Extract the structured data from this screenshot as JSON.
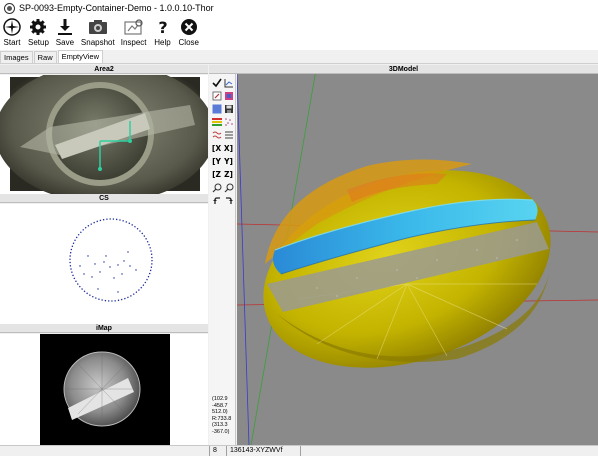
{
  "window": {
    "title": "SP-0093-Empty-Container-Demo - 1.0.0.10-Thor"
  },
  "toolbar": {
    "buttons": [
      {
        "label": "Start",
        "icon": "start-icon"
      },
      {
        "label": "Setup",
        "icon": "gear-icon"
      },
      {
        "label": "Save",
        "icon": "download-icon"
      },
      {
        "label": "Snapshot",
        "icon": "camera-icon"
      },
      {
        "label": "Inspect",
        "icon": "inspect-icon"
      },
      {
        "label": "Help",
        "icon": "help-icon"
      },
      {
        "label": "Close",
        "icon": "close-icon"
      }
    ]
  },
  "tabs": [
    {
      "label": "Images"
    },
    {
      "label": "Raw"
    },
    {
      "label": "EmptyView",
      "active": true
    }
  ],
  "panels": {
    "area2": {
      "title": "Area2"
    },
    "cs": {
      "title": "CS"
    },
    "imap": {
      "title": "iMap"
    },
    "model": {
      "title": "3DModel"
    }
  },
  "tools": {
    "x_minus": "[X",
    "x_plus": "X]",
    "y_minus": "[Y",
    "y_plus": "Y]",
    "z_minus": "[Z",
    "z_plus": "Z]"
  },
  "coords": {
    "line1": "(102.9",
    "line2": "-458.7",
    "line3": "512.0)",
    "line4": "R:733.8",
    "line5": "(313.3",
    "line6": "-367.0)"
  },
  "statusbar": {
    "cell1": "8",
    "cell2": "136143-XYZWVf"
  },
  "colors": {
    "viewport_bg": "#8a8a8a",
    "model_yellow": "#c9b400",
    "model_stripe": "#3ab0e6",
    "axis_green": "#3aa03a",
    "axis_blue": "#3a3ad0",
    "axis_red": "#c03030",
    "cs_dots": "#1a2a9a"
  }
}
